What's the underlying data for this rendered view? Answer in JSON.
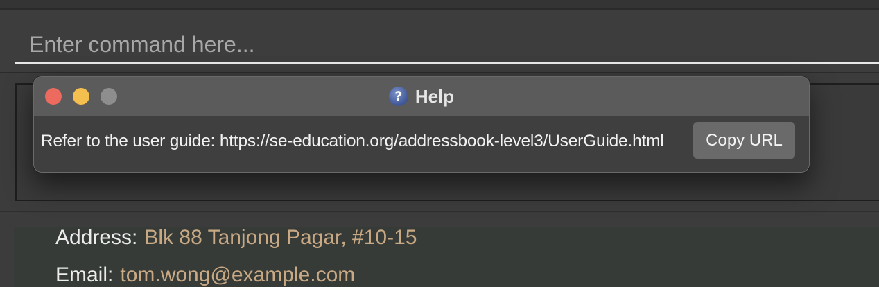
{
  "command_box": {
    "placeholder": "Enter command here..."
  },
  "person_card": {
    "address_label": "Address:",
    "address_value": "Blk 88 Tanjong Pagar, #10-15",
    "email_label": "Email:",
    "email_value": "tom.wong@example.com"
  },
  "help_window": {
    "title": "Help",
    "icon": "help-question-icon",
    "message": "Refer to the user guide: https://se-education.org/addressbook-level3/UserGuide.html",
    "copy_button_label": "Copy URL",
    "icon_glyph": "?"
  },
  "colors": {
    "background": "#3c3c3c",
    "field_value": "#c9a984",
    "close_button": "#ed6a5e",
    "minimize_button": "#f5bf4f",
    "zoom_button_disabled": "#8e8e8e"
  }
}
